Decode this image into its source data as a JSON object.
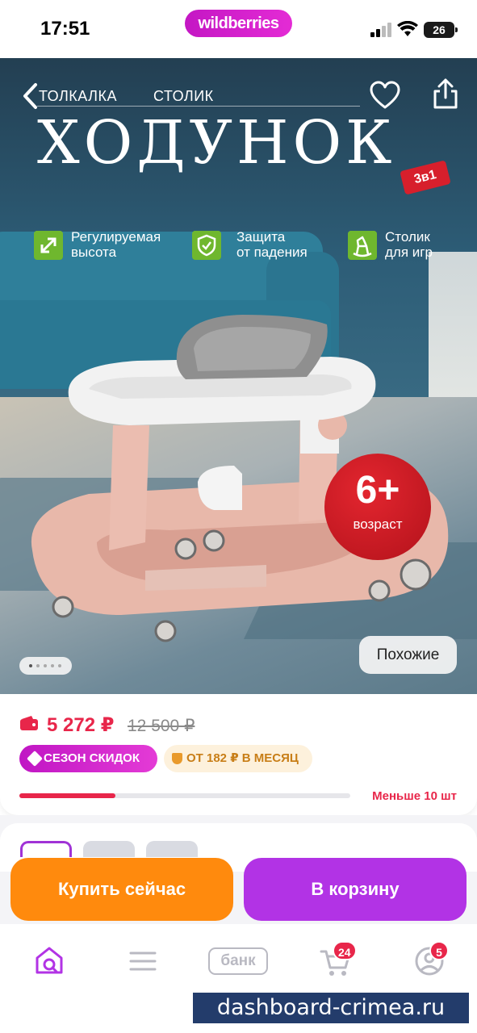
{
  "status_bar": {
    "time": "17:51",
    "brand": "wildberries",
    "battery": "26"
  },
  "hero": {
    "nav_links": [
      "ТОЛКАЛКА",
      "СТОЛИК"
    ],
    "title": "ХОДУНОК",
    "badge": "3в1",
    "features": [
      {
        "icon": "expand-arrows-icon",
        "line1": "Регулируемая",
        "line2": "высота"
      },
      {
        "icon": "shield-check-icon",
        "line1": "Защита",
        "line2": "от падения"
      },
      {
        "icon": "rocking-horse-icon",
        "line1": "Столик",
        "line2": "для игр"
      }
    ],
    "age_main": "6+",
    "age_sub": "возраст",
    "similar_label": "Похожие",
    "carousel_dots": 5,
    "carousel_active": 0
  },
  "price": {
    "current": "5 272 ₽",
    "old": "12 500 ₽",
    "sale_tag": "СЕЗОН СКИДОК",
    "installment": "ОТ 182 ₽ В МЕСЯЦ",
    "stock_text": "Меньше 10 шт",
    "stock_fraction": 0.29
  },
  "actions": {
    "buy_now": "Купить сейчас",
    "add_to_cart": "В корзину"
  },
  "tabbar": {
    "bank_label": "банк",
    "cart_badge": "24",
    "profile_badge": "5"
  },
  "watermark": "dashboard-crimea.ru",
  "colors": {
    "brand": "#cb1fcb",
    "price": "#e8264a",
    "buy": "#ff8a0d",
    "cart": "#b233e5"
  }
}
